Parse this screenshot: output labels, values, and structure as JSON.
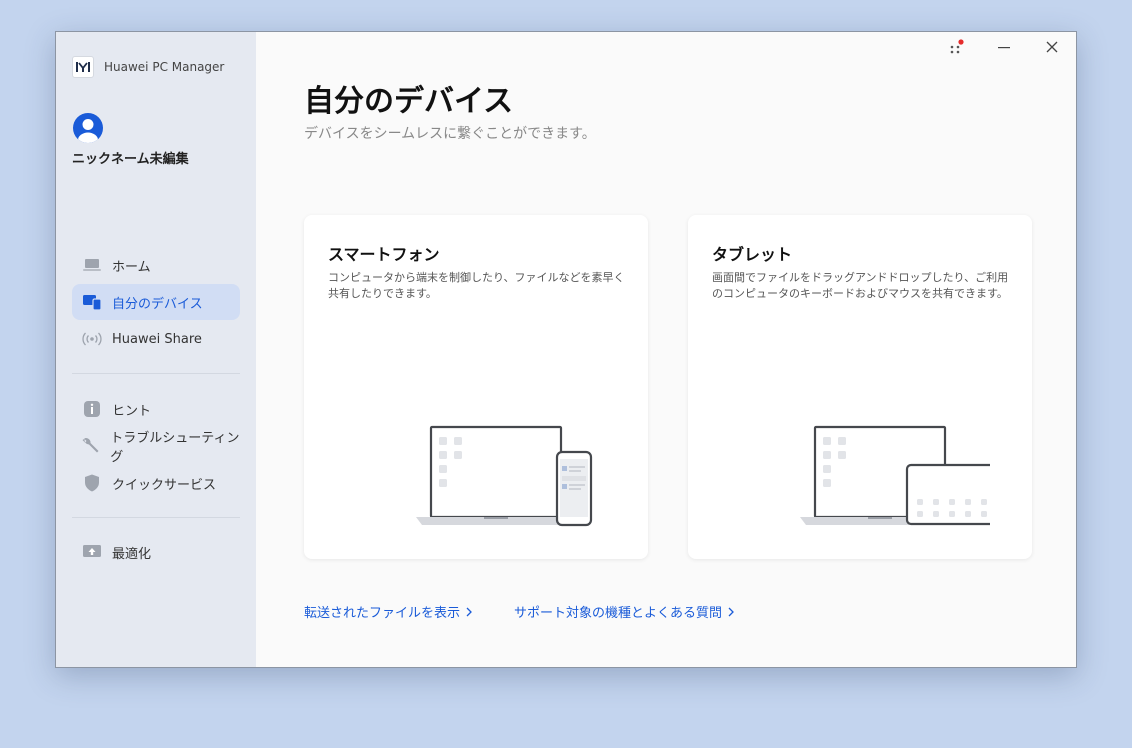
{
  "app": {
    "title": "Huawei PC Manager"
  },
  "user": {
    "nickname": "ニックネーム未編集"
  },
  "sidebar": {
    "items": [
      {
        "label": "ホーム",
        "icon": "laptop-icon",
        "active": false
      },
      {
        "label": "自分のデバイス",
        "icon": "devices-icon",
        "active": true
      },
      {
        "label": "Huawei Share",
        "icon": "wireless-icon",
        "active": false
      },
      {
        "label": "ヒント",
        "icon": "info-icon",
        "active": false
      },
      {
        "label": "トラブルシューティング",
        "icon": "wrench-icon",
        "active": false
      },
      {
        "label": "クイックサービス",
        "icon": "shield-icon",
        "active": false
      },
      {
        "label": "最適化",
        "icon": "optimize-icon",
        "active": false
      }
    ]
  },
  "main": {
    "title": "自分のデバイス",
    "subtitle": "デバイスをシームレスに繋ぐことができます。",
    "cards": [
      {
        "title": "スマートフォン",
        "description": "コンピュータから端末を制御したり、ファイルなどを素早く共有したりできます。"
      },
      {
        "title": "タブレット",
        "description": "画面間でファイルをドラッグアンドドロップしたり、ご利用のコンピュータのキーボードおよびマウスを共有できます。"
      }
    ],
    "links": [
      {
        "label": "転送されたファイルを表示"
      },
      {
        "label": "サポート対象の機種とよくある質問"
      }
    ]
  },
  "colors": {
    "accent": "#1a5bd8",
    "notification": "#e52b2b",
    "sidebar_bg": "#e5e9f1",
    "active_bg": "#d1ddf4"
  }
}
